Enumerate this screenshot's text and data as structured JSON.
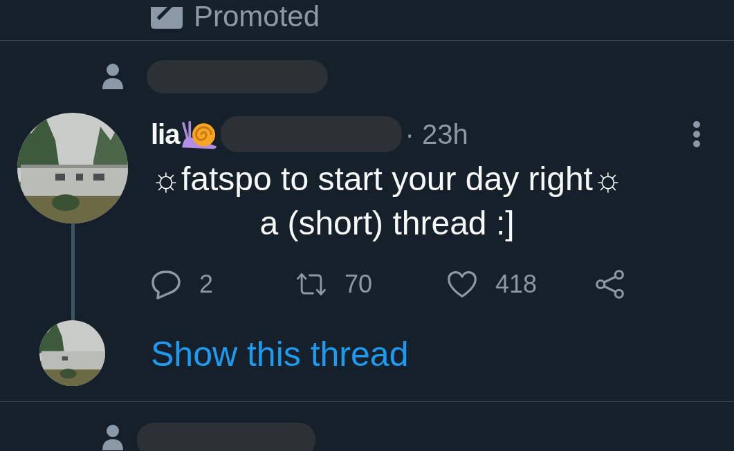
{
  "promoted_label": "Promoted",
  "tweet": {
    "name": "lia",
    "time": "· 23h",
    "text_lines": [
      "☼fatspo to start your day right☼",
      "a (short) thread :]"
    ],
    "actions": [
      {
        "kind": "reply",
        "count": "2"
      },
      {
        "kind": "retweet",
        "count": "70"
      },
      {
        "kind": "like",
        "count": "418"
      },
      {
        "kind": "share"
      }
    ],
    "show_thread": "Show this thread"
  }
}
